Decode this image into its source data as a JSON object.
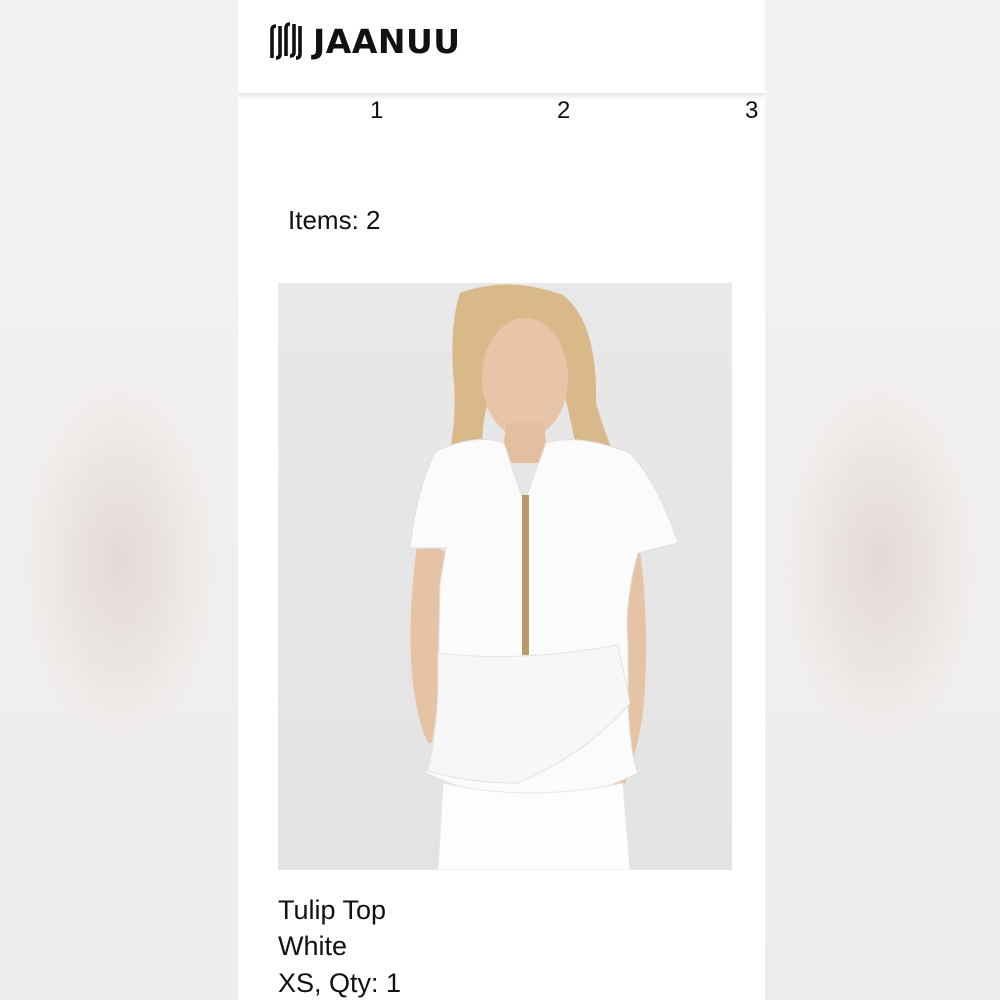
{
  "brand": {
    "name": "JAANUU",
    "logo_icon": "jaanuu-logo-mark"
  },
  "pagination": {
    "pages": [
      "1",
      "2",
      "3"
    ]
  },
  "cart": {
    "items_label": "Items: 2"
  },
  "product": {
    "image_icon": "product-photo",
    "name": "Tulip Top",
    "color": "White",
    "size_qty": "XS, Qty: 1"
  },
  "colors": {
    "text": "#111111",
    "background": "#ffffff"
  }
}
